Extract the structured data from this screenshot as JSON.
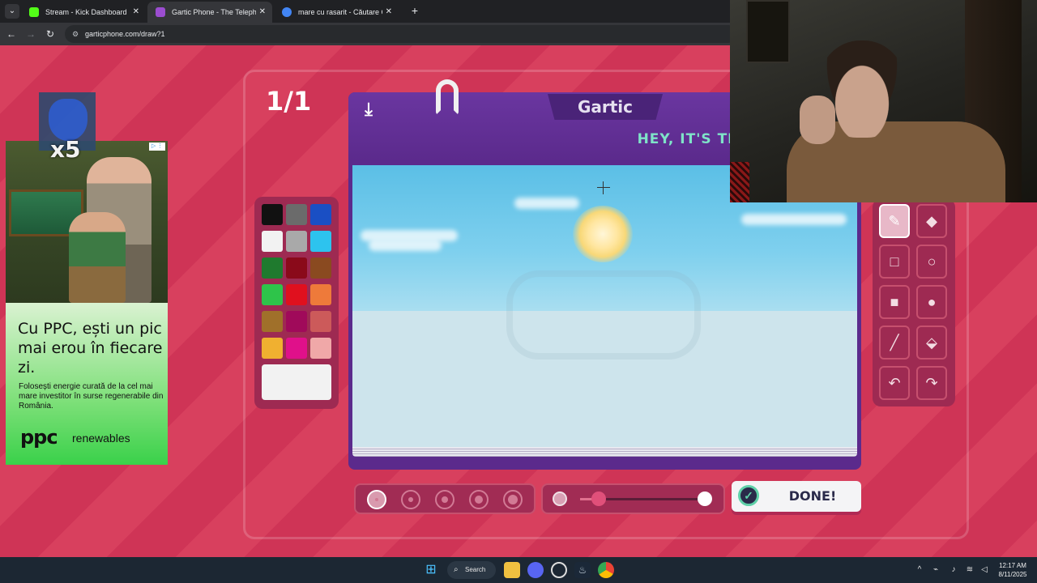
{
  "browser": {
    "tabs": [
      {
        "title": "Stream - Kick Dashboard",
        "favicon_color": "#53fc18",
        "active": false
      },
      {
        "title": "Gartic Phone - The Telephone G",
        "favicon_color": "#9b4dd0",
        "active": true
      },
      {
        "title": "mare cu rasarit - Căutare Goog",
        "favicon_color": "#4285f4",
        "active": false
      }
    ],
    "url": "garticphone.com/draw?1"
  },
  "ad": {
    "multiplier": "x5",
    "headline": "Cu PPC, ești un pic mai erou în fiecare zi.",
    "body": "Folosești energie curată de la cel mai mare investitor în surse regenerabile din România.",
    "brand": "ppc",
    "brand_sub": "renewables"
  },
  "game": {
    "round": "1/1",
    "logo": "Gartic",
    "message": "HEY, IT'S TIME TO DRAW!",
    "palette": [
      "#111111",
      "#6b6b6b",
      "#1a4fc4",
      "#f2f2f2",
      "#a9a9a9",
      "#2dc3ee",
      "#1f7a2e",
      "#8a0a1a",
      "#8a4a20",
      "#2ec44a",
      "#e0101e",
      "#ee7a3a",
      "#a0702a",
      "#a00a5a",
      "#cc5a5a",
      "#f0b030",
      "#e0108a",
      "#f0a8a8"
    ],
    "selected_color": "#f2f2f2",
    "tools": [
      "pencil-icon",
      "eraser-icon",
      "rectangle-outline-icon",
      "circle-outline-icon",
      "rectangle-fill-icon",
      "circle-fill-icon",
      "line-icon",
      "bucket-icon",
      "undo-icon",
      "redo-icon"
    ],
    "selected_tool": "pencil-icon",
    "brush_sizes": [
      1,
      2,
      3,
      4,
      5
    ],
    "selected_size": 1,
    "opacity": 0.15,
    "done_label": "DONE!"
  },
  "taskbar": {
    "search_label": "Search",
    "time": "12:17 AM",
    "date": "8/11/2025"
  }
}
